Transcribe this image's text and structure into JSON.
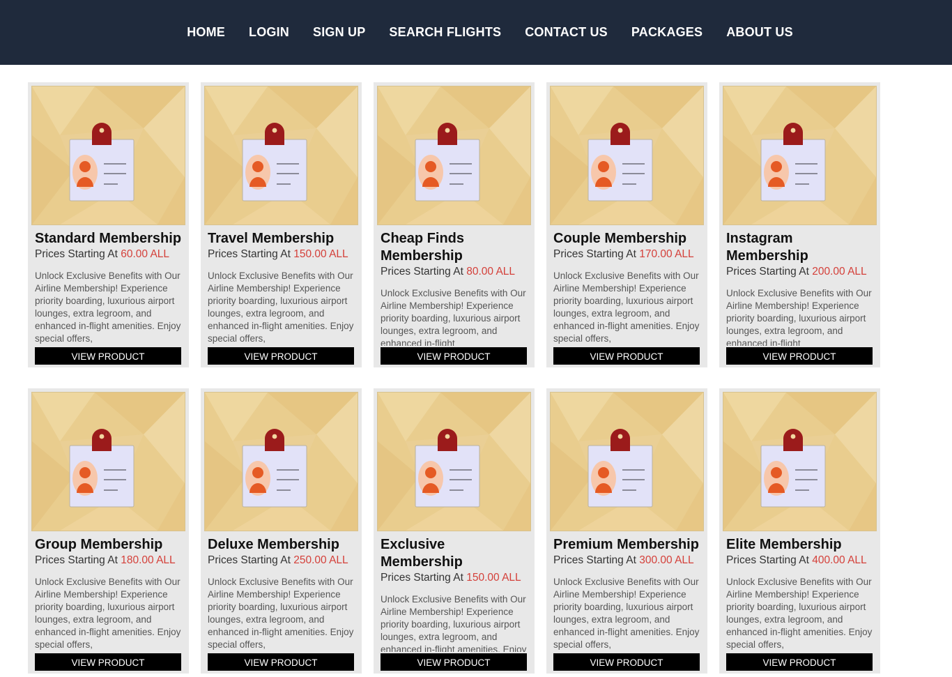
{
  "nav": {
    "items": [
      {
        "label": "HOME"
      },
      {
        "label": "LOGIN"
      },
      {
        "label": "SIGN UP"
      },
      {
        "label": "SEARCH FLIGHTS"
      },
      {
        "label": "CONTACT US"
      },
      {
        "label": "PACKAGES"
      },
      {
        "label": "ABOUT US"
      }
    ]
  },
  "cards": [
    {
      "title": "Standard Membership",
      "price_prefix": "Prices Starting At ",
      "price": "60.00 ALL",
      "description": "Unlock Exclusive Benefits with Our Airline Membership! Experience priority boarding, luxurious airport lounges, extra legroom, and enhanced in-flight amenities. Enjoy special offers,",
      "button": "VIEW PRODUCT"
    },
    {
      "title": "Travel Membership",
      "price_prefix": "Prices Starting At ",
      "price": "150.00 ALL",
      "description": "Unlock Exclusive Benefits with Our Airline Membership! Experience priority boarding, luxurious airport lounges, extra legroom, and enhanced in-flight amenities. Enjoy special offers,",
      "button": "VIEW PRODUCT"
    },
    {
      "title": "Cheap Finds Membership",
      "price_prefix": "Prices Starting At ",
      "price": "80.00 ALL",
      "description": "Unlock Exclusive Benefits with Our Airline Membership! Experience priority boarding, luxurious airport lounges, extra legroom, and enhanced in-flight",
      "button": "VIEW PRODUCT"
    },
    {
      "title": "Couple Membership",
      "price_prefix": "Prices Starting At ",
      "price": "170.00 ALL",
      "description": "Unlock Exclusive Benefits with Our Airline Membership! Experience priority boarding, luxurious airport lounges, extra legroom, and enhanced in-flight amenities. Enjoy special offers,",
      "button": "VIEW PRODUCT"
    },
    {
      "title": "Instagram Membership",
      "price_prefix": "Prices Starting At ",
      "price": "200.00 ALL",
      "description": "Unlock Exclusive Benefits with Our Airline Membership! Experience priority boarding, luxurious airport lounges, extra legroom, and enhanced in-flight",
      "button": "VIEW PRODUCT"
    },
    {
      "title": "Group Membership",
      "price_prefix": "Prices Starting At ",
      "price": "180.00 ALL",
      "description": "Unlock Exclusive Benefits with Our Airline Membership! Experience priority boarding, luxurious airport lounges, extra legroom, and enhanced in-flight amenities. Enjoy special offers,",
      "button": "VIEW PRODUCT"
    },
    {
      "title": "Deluxe Membership",
      "price_prefix": "Prices Starting At ",
      "price": "250.00 ALL",
      "description": "Unlock Exclusive Benefits with Our Airline Membership! Experience priority boarding, luxurious airport lounges, extra legroom, and enhanced in-flight amenities. Enjoy special offers,",
      "button": "VIEW PRODUCT"
    },
    {
      "title": "Exclusive Membership",
      "price_prefix": "Prices Starting At ",
      "price": "150.00 ALL",
      "description": "Unlock Exclusive Benefits with Our Airline Membership! Experience priority boarding, luxurious airport lounges, extra legroom, and enhanced in-flight amenities. Enjoy special offers,",
      "button": "VIEW PRODUCT"
    },
    {
      "title": "Premium Membership",
      "price_prefix": "Prices Starting At ",
      "price": "300.00 ALL",
      "description": "Unlock Exclusive Benefits with Our Airline Membership! Experience priority boarding, luxurious airport lounges, extra legroom, and enhanced in-flight amenities. Enjoy special offers,",
      "button": "VIEW PRODUCT"
    },
    {
      "title": "Elite Membership",
      "price_prefix": "Prices Starting At ",
      "price": "400.00 ALL",
      "description": "Unlock Exclusive Benefits with Our Airline Membership! Experience priority boarding, luxurious airport lounges, extra legroom, and enhanced in-flight amenities. Enjoy special offers,",
      "button": "VIEW PRODUCT"
    }
  ],
  "colors": {
    "nav_background": "#1f2a3c",
    "card_background": "#e8e8e8",
    "price_accent": "#d4403a",
    "button_background": "#000000"
  },
  "icons": {
    "card_image": "membership-id-badge-icon"
  }
}
